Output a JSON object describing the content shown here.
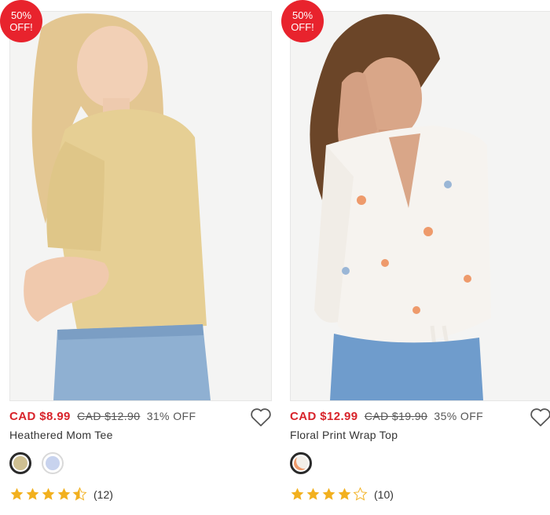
{
  "products": [
    {
      "badge": {
        "line1": "50%",
        "line2": "OFF!"
      },
      "price": {
        "current": "CAD $8.99",
        "original": "CAD $12.90",
        "discount": "31% OFF"
      },
      "title": "Heathered Mom Tee",
      "swatches": [
        {
          "color": "#cfc092",
          "selected": true
        },
        {
          "color": "#c8d3ee",
          "selected": false
        }
      ],
      "rating": 4.5,
      "reviews": "(12)",
      "image": {
        "shirt_color": "#e6cf94",
        "jeans_color": "#8fb0d2",
        "skin_color": "#f2d0b6",
        "hair_color": "#e3c691"
      }
    },
    {
      "badge": {
        "line1": "50%",
        "line2": "OFF!"
      },
      "price": {
        "current": "CAD $12.99",
        "original": "CAD $19.90",
        "discount": "35% OFF"
      },
      "title": "Floral Print Wrap Top",
      "swatches": [
        {
          "color": "#f3efe9",
          "selected": true
        }
      ],
      "rating": 4,
      "reviews": "(10)",
      "image": {
        "shirt_color": "#f6f3ef",
        "jeans_color": "#6f9ccc",
        "skin_color": "#d9a688",
        "hair_color": "#6b4528"
      }
    }
  ],
  "colors": {
    "sale_red": "#d8232a",
    "badge_red": "#e8232d",
    "star_gold": "#f2b01e"
  }
}
